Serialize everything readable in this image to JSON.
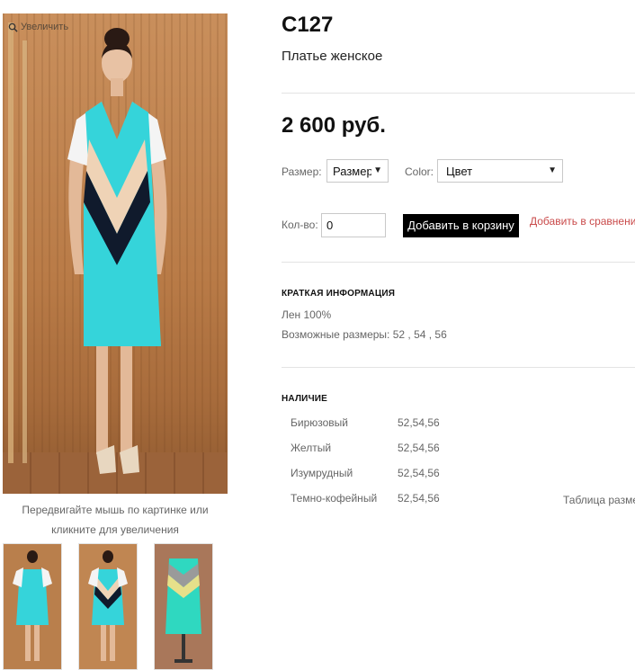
{
  "gallery": {
    "zoom_label": "Увеличить",
    "caption": "Передвигайте мышь по картинке или кликните для увеличения",
    "thumbnails": [
      "thumb-back",
      "thumb-front",
      "thumb-mannequin"
    ]
  },
  "product": {
    "sku": "С127",
    "subtitle": "Платье женское",
    "price": "2 600 руб."
  },
  "options": {
    "size_label": "Размер:",
    "size_value": "Размер",
    "color_label": "Color:",
    "color_value": "Цвет"
  },
  "purchase": {
    "qty_label": "Кол-во:",
    "qty_value": "0",
    "add_to_cart": "Добавить в корзину",
    "add_to_compare": "Добавить в сравнение"
  },
  "brief": {
    "title": "КРАТКАЯ ИНФОРМАЦИЯ",
    "material": "Лен 100%",
    "sizes": "Возможные размеры: 52 , 54 , 56"
  },
  "availability": {
    "title": "НАЛИЧИЕ",
    "rows": [
      {
        "color": "Бирюзовый",
        "sizes": "52,54,56"
      },
      {
        "color": "Желтый",
        "sizes": "52,54,56"
      },
      {
        "color": "Изумрудный",
        "sizes": "52,54,56"
      },
      {
        "color": "Темно-кофейный",
        "sizes": "52,54,56"
      }
    ],
    "size_table_link": "Таблица размеров"
  },
  "colors": {
    "dress_turquoise": "#35d4da",
    "dress_beige": "#efd3b6",
    "dress_navy": "#101a2c",
    "dress_sleeve": "#f4f4f4",
    "compare_link": "#c94a4a",
    "cart_button": "#000000"
  }
}
